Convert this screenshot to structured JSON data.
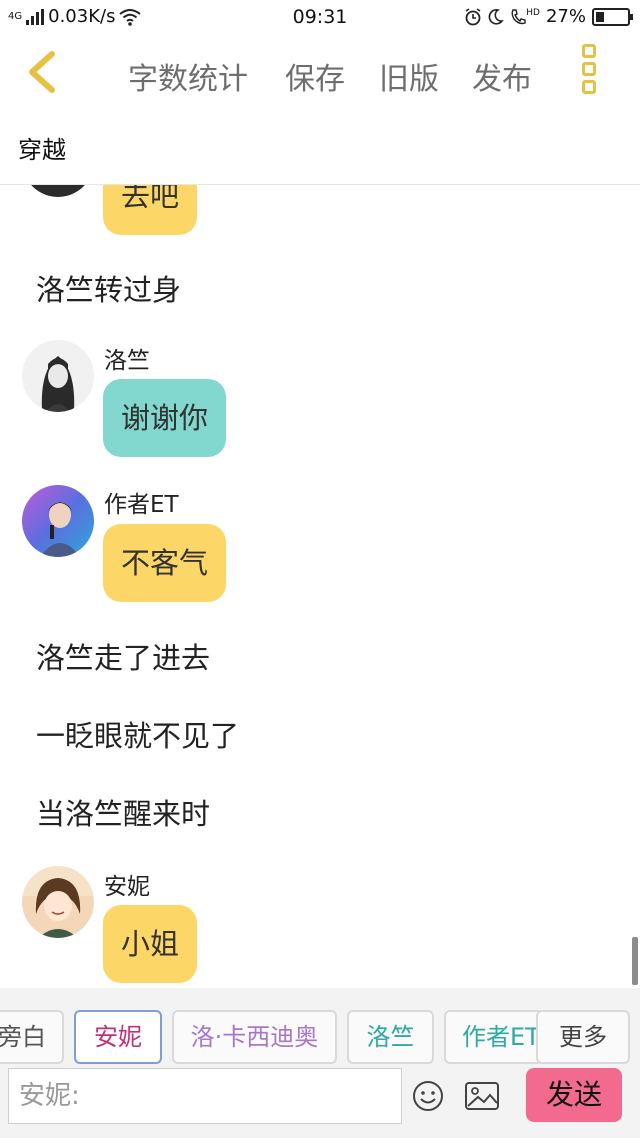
{
  "status_bar": {
    "network_type": "4G",
    "speed": "0.03K/s",
    "time": "09:31",
    "hd_label": "HD",
    "battery_percent_text": "27%",
    "battery_level": 0.27
  },
  "toolbar": {
    "word_count_label": "字数统计",
    "save_label": "保存",
    "old_version_label": "旧版",
    "publish_label": "发布"
  },
  "document": {
    "title": "穿越"
  },
  "story": {
    "partial_bubble": "去吧",
    "narration_1": "洛竺转过身",
    "msg_1": {
      "speaker": "洛竺",
      "text": "谢谢你",
      "color": "#82d8cf"
    },
    "msg_2": {
      "speaker": "作者ET",
      "text": "不客气",
      "color": "#fcd767"
    },
    "narration_2": "洛竺走了进去",
    "narration_3": "一眨眼就不见了",
    "narration_4": "当洛竺醒来时",
    "msg_3": {
      "speaker": "安妮",
      "text": "小姐",
      "color": "#fcd767"
    }
  },
  "roles": {
    "chips": [
      {
        "label": "旁白",
        "color": "#555555"
      },
      {
        "label": "安妮",
        "color": "#c0307a"
      },
      {
        "label": "洛·卡西迪奥",
        "color": "#a778c9"
      },
      {
        "label": "洛竺",
        "color": "#2eaaa0"
      },
      {
        "label": "作者ET",
        "color": "#2eaaa0"
      }
    ],
    "more_label": "更多"
  },
  "composer": {
    "placeholder": "安妮:",
    "send_label": "发送"
  },
  "colors": {
    "accent_yellow": "#fcd767",
    "accent_teal": "#82d8cf",
    "send_pink": "#f26a8e"
  }
}
